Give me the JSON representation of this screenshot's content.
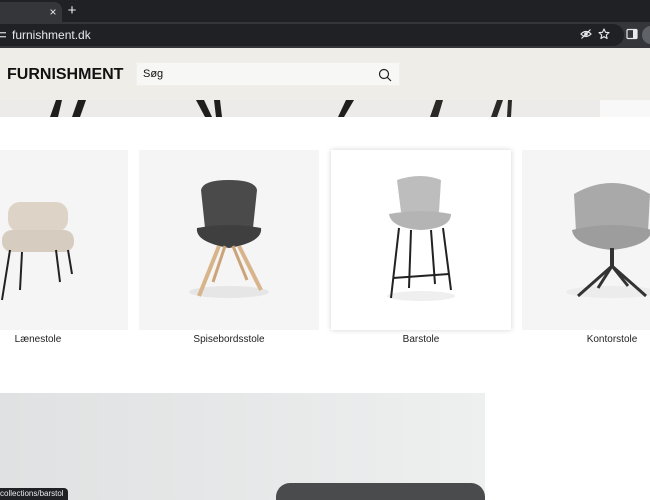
{
  "browser": {
    "tab_close": "×",
    "new_tab": "+",
    "url": "furnishment.dk",
    "status_url": "collections/barstol"
  },
  "header": {
    "logo": "FURNISHMENT",
    "search_value": "Søg"
  },
  "categories": [
    {
      "label": "Lænestole"
    },
    {
      "label": "Spisebordsstole"
    },
    {
      "label": "Barstole"
    },
    {
      "label": "Kontorstole"
    }
  ],
  "colors": {
    "chrome_dark": "#202124",
    "header_bg": "#efede8",
    "card_bg": "#f5f5f5"
  },
  "icons": [
    "site-info-icon",
    "eye-off-icon",
    "star-icon",
    "side-panel-icon",
    "search-icon",
    "close-icon",
    "plus-icon"
  ]
}
